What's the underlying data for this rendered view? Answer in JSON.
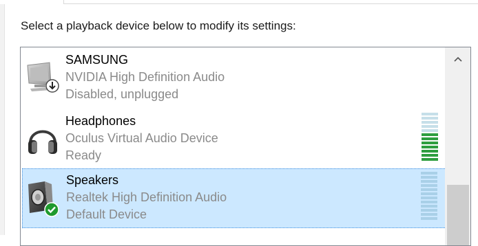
{
  "instruction": "Select a playback device below to modify its settings:",
  "devices": [
    {
      "name": "SAMSUNG",
      "driver": "NVIDIA High Definition Audio",
      "status": "Disabled, unplugged",
      "icon": "monitor-speaker-icon",
      "overlay": "down-arrow-badge-icon",
      "selected": false,
      "level": 0
    },
    {
      "name": "Headphones",
      "driver": "Oculus Virtual Audio Device",
      "status": "Ready",
      "icon": "headphones-icon",
      "selected": false,
      "level": 0.55
    },
    {
      "name": "Speakers",
      "driver": "Realtek High Definition Audio",
      "status": "Default Device",
      "icon": "speaker-icon",
      "overlay": "green-check-badge-icon",
      "selected": true,
      "level": 0
    }
  ],
  "colors": {
    "selection": "#cce8ff",
    "meter_active": "#2e9e3f",
    "meter_idle": "#c6dfe9",
    "meter_idle_selected": "#a9d0e8",
    "check": "#1f9a2e"
  }
}
